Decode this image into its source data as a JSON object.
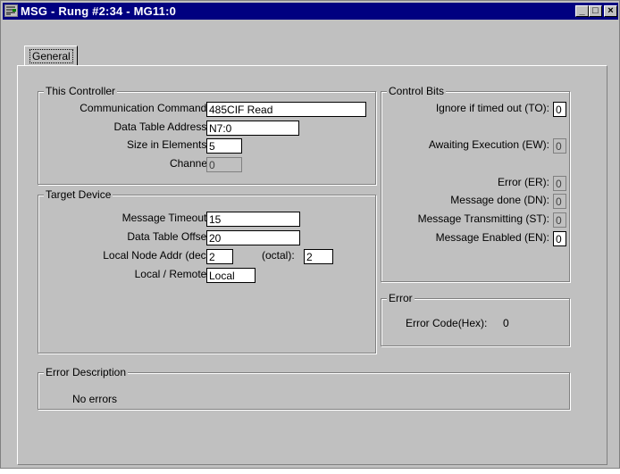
{
  "window": {
    "title": "MSG - Rung #2:34 - MG11:0",
    "minimize": "_",
    "maximize": "□",
    "close": "×"
  },
  "tabs": [
    {
      "label": "General"
    }
  ],
  "this_controller": {
    "title": "This Controller",
    "communication_command": {
      "label": "Communication Command :",
      "value": "485CIF Read"
    },
    "data_table_address": {
      "label": "Data Table Address :",
      "value": "N7:0"
    },
    "size_in_elements": {
      "label": "Size in Elements :",
      "value": "5"
    },
    "channel": {
      "label": "Channel:",
      "value": "0"
    }
  },
  "target_device": {
    "title": "Target Device",
    "message_timeout": {
      "label": "Message Timeout :",
      "value": "15"
    },
    "data_table_offset": {
      "label": "Data Table Offset:",
      "value": "20"
    },
    "local_node_addr": {
      "label": "Local Node Addr (dec):",
      "value": "2",
      "octal_label": "(octal):",
      "octal_value": "2"
    },
    "local_remote": {
      "label": "Local / Remote :",
      "value": "Local"
    }
  },
  "control_bits": {
    "title": "Control Bits",
    "to": {
      "label": "Ignore if timed out (TO):",
      "value": "0"
    },
    "ew": {
      "label": "Awaiting Execution (EW):",
      "value": "0"
    },
    "er": {
      "label": "Error (ER):",
      "value": "0"
    },
    "dn": {
      "label": "Message done (DN):",
      "value": "0"
    },
    "st": {
      "label": "Message Transmitting (ST):",
      "value": "0"
    },
    "en": {
      "label": "Message Enabled (EN):",
      "value": "0"
    }
  },
  "error": {
    "title": "Error",
    "code_label": "Error Code(Hex):",
    "code_value": "0"
  },
  "error_description": {
    "title": "Error Description",
    "text": "No errors"
  },
  "colors": {
    "titlebar": "#000080",
    "face": "#c0c0c0"
  }
}
